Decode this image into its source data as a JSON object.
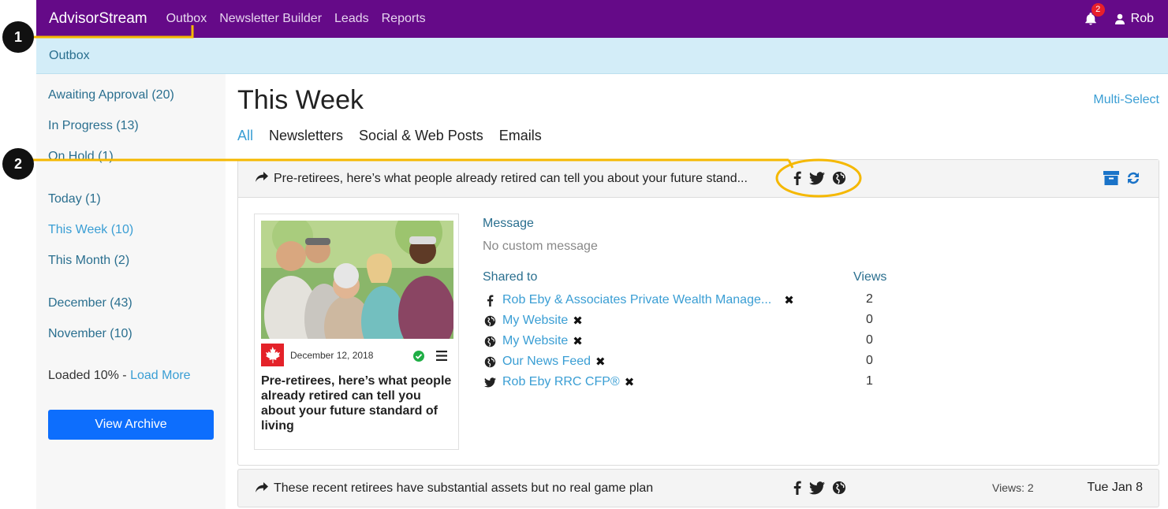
{
  "nav": {
    "brand": "AdvisorStream",
    "links": [
      "Outbox",
      "Newsletter Builder",
      "Leads",
      "Reports"
    ],
    "notification_count": "2",
    "user": "Rob"
  },
  "subheader": "Outbox",
  "sidebar": {
    "group1": [
      "Awaiting Approval (20)",
      "In Progress (13)",
      "On Hold (1)"
    ],
    "group2": [
      "Today (1)",
      "This Week (10)",
      "This Month (2)"
    ],
    "group3": [
      "December (43)",
      "November (10)"
    ],
    "loaded_text": "Loaded 10% - ",
    "load_more": "Load More",
    "archive_button": "View Archive"
  },
  "main": {
    "title": "This Week",
    "multi_select": "Multi-Select",
    "tabs": [
      "All",
      "Newsletters",
      "Social & Web Posts",
      "Emails"
    ]
  },
  "card1": {
    "title": "Pre-retirees, here’s what people already retired can tell you about your future stand...",
    "thumb_date": "December 12, 2018",
    "thumb_title": "Pre-retirees, here’s what people already retired can tell you about your future standard of living",
    "message_label": "Message",
    "message_text": "No custom message",
    "shared_label": "Shared to",
    "views_label": "Views",
    "shares": [
      {
        "icon": "facebook-icon",
        "name": "Rob Eby & Associates Private Wealth Manage...",
        "views": "2"
      },
      {
        "icon": "globe-icon",
        "name": "My Website",
        "views": "0"
      },
      {
        "icon": "globe-icon",
        "name": "My Website",
        "views": "0"
      },
      {
        "icon": "globe-icon",
        "name": "Our News Feed",
        "views": "0"
      },
      {
        "icon": "twitter-icon",
        "name": "Rob Eby RRC CFP®",
        "views": "1"
      }
    ],
    "remove_glyph": "✖"
  },
  "card2": {
    "title": "These recent retirees have substantial assets but no real game plan",
    "views": "Views: 2",
    "date": "Tue Jan 8"
  },
  "annotations": {
    "marker1": "1",
    "marker2": "2"
  },
  "colors": {
    "nav": "#650a88",
    "subheader": "#d3edf8",
    "link": "#3a9ed4",
    "annotation": "#f5b800",
    "button": "#0d6efd"
  }
}
